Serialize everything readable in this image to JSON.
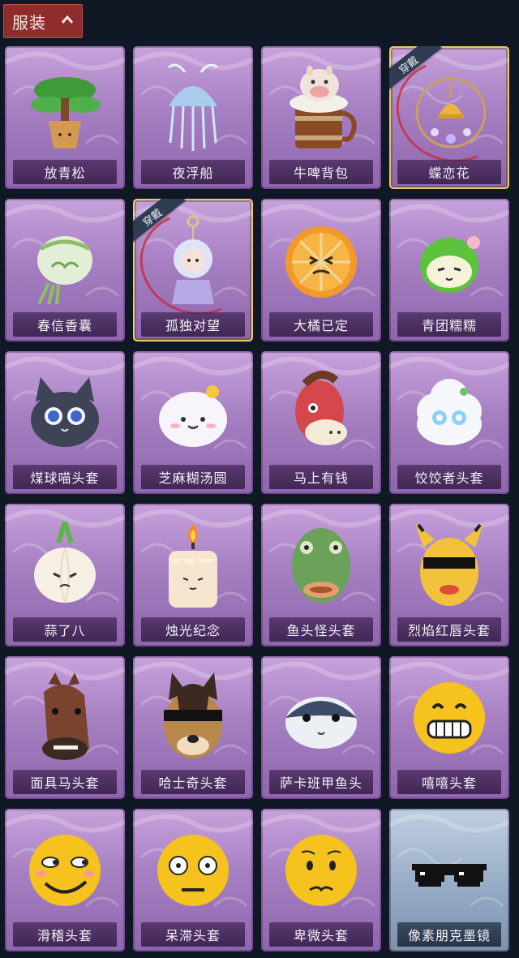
{
  "header": {
    "title": "服装"
  },
  "worn_badge": "穿戴",
  "items": [
    {
      "label": "放青松",
      "icon": "bonsai-pine-icon",
      "theme": "purple",
      "worn": false
    },
    {
      "label": "夜浮船",
      "icon": "jellyfish-icon",
      "theme": "purple",
      "worn": false
    },
    {
      "label": "牛啤背包",
      "icon": "cow-beer-mug-icon",
      "theme": "purple",
      "worn": false
    },
    {
      "label": "蝶恋花",
      "icon": "butterfly-bell-ornament-icon",
      "theme": "purple",
      "worn": true
    },
    {
      "label": "春信香囊",
      "icon": "sachet-pouch-icon",
      "theme": "purple",
      "worn": false
    },
    {
      "label": "孤独对望",
      "icon": "doll-charm-icon",
      "theme": "purple",
      "worn": true
    },
    {
      "label": "大橘已定",
      "icon": "orange-slice-face-icon",
      "theme": "purple",
      "worn": false
    },
    {
      "label": "青团糯糯",
      "icon": "green-rice-ball-icon",
      "theme": "purple",
      "worn": false
    },
    {
      "label": "煤球喵头套",
      "icon": "black-cat-head-icon",
      "theme": "purple",
      "worn": false
    },
    {
      "label": "芝麻糊汤圆",
      "icon": "rice-dumpling-face-icon",
      "theme": "purple",
      "worn": false
    },
    {
      "label": "马上有钱",
      "icon": "red-horse-head-icon",
      "theme": "purple",
      "worn": false
    },
    {
      "label": "饺饺者头套",
      "icon": "cloud-dumpling-head-icon",
      "theme": "purple",
      "worn": false
    },
    {
      "label": "蒜了八",
      "icon": "garlic-face-icon",
      "theme": "purple",
      "worn": false
    },
    {
      "label": "烛光纪念",
      "icon": "candle-face-icon",
      "theme": "purple",
      "worn": false
    },
    {
      "label": "鱼头怪头套",
      "icon": "fish-head-mask-icon",
      "theme": "purple",
      "worn": false
    },
    {
      "label": "烈焰红唇头套",
      "icon": "yellow-sunglasses-mask-icon",
      "theme": "purple",
      "worn": false
    },
    {
      "label": "面具马头套",
      "icon": "horse-head-mask-icon",
      "theme": "purple",
      "worn": false
    },
    {
      "label": "哈士奇头套",
      "icon": "husky-sunglasses-icon",
      "theme": "purple",
      "worn": false
    },
    {
      "label": "萨卡班甲鱼头",
      "icon": "round-fish-head-icon",
      "theme": "purple",
      "worn": false
    },
    {
      "label": "嘻嘻头套",
      "icon": "grin-emoji-icon",
      "theme": "purple",
      "worn": false
    },
    {
      "label": "滑稽头套",
      "icon": "smirk-emoji-icon",
      "theme": "purple",
      "worn": false
    },
    {
      "label": "呆滞头套",
      "icon": "dazed-emoji-icon",
      "theme": "purple",
      "worn": false
    },
    {
      "label": "卑微头套",
      "icon": "timid-emoji-icon",
      "theme": "purple",
      "worn": false
    },
    {
      "label": "像素朋克墨镜",
      "icon": "pixel-sunglasses-icon",
      "theme": "blue",
      "worn": false
    }
  ]
}
